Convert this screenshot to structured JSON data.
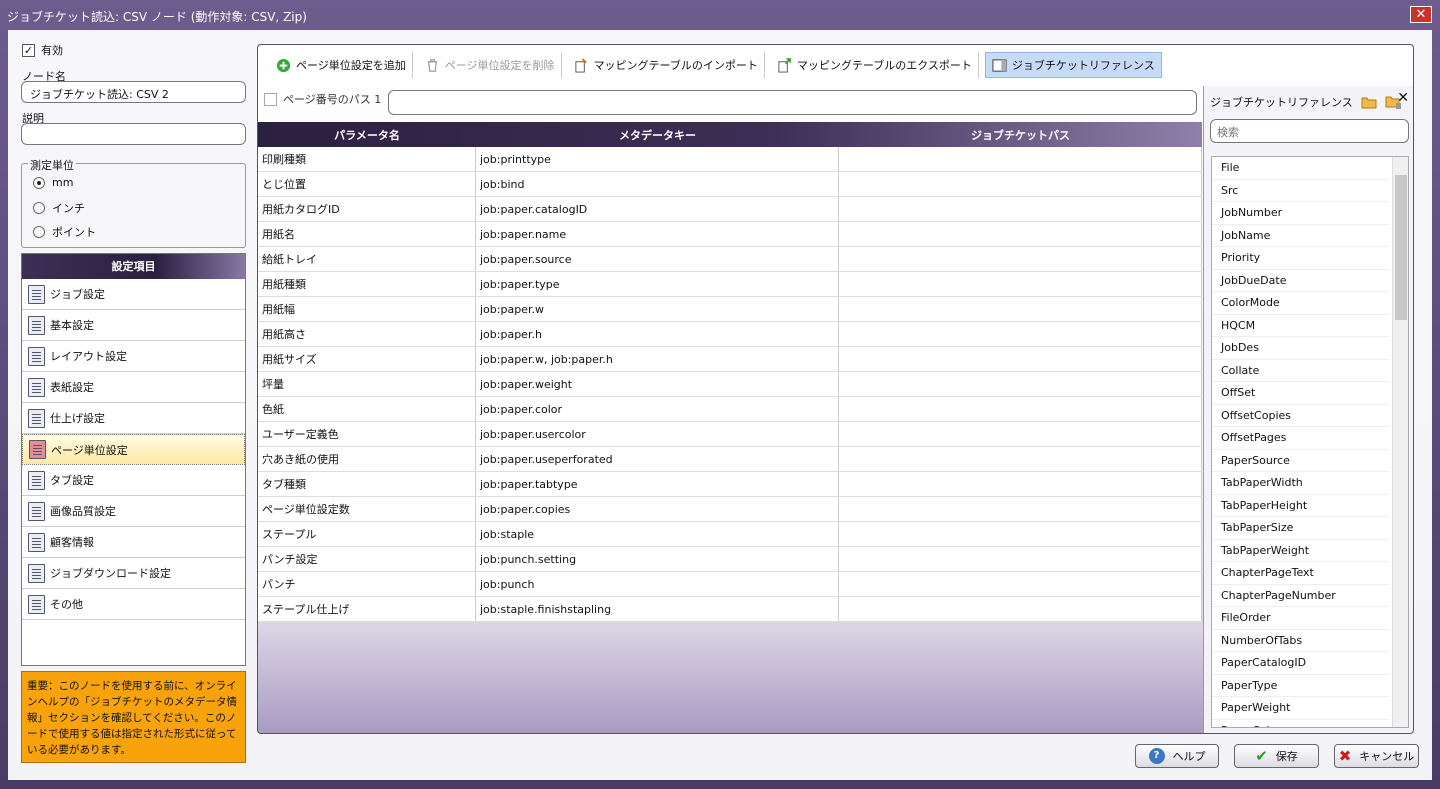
{
  "window": {
    "title": "ジョブチケット読込: CSV ノード (動作対象: CSV, Zip)",
    "close": "✕"
  },
  "left": {
    "enabled_label": "有効",
    "node_name_label": "ノード名",
    "node_name_value": "ジョブチケット読込: CSV 2",
    "description_label": "説明",
    "description_value": "",
    "unit_group_label": "測定単位",
    "units": [
      {
        "label": "mm",
        "selected": true
      },
      {
        "label": "インチ",
        "selected": false
      },
      {
        "label": "ポイント",
        "selected": false
      }
    ],
    "settings_header": "設定項目",
    "settings_items": [
      {
        "label": "ジョブ設定",
        "icon": "document-icon"
      },
      {
        "label": "基本設定",
        "icon": "list-icon"
      },
      {
        "label": "レイアウト設定",
        "icon": "layout-icon"
      },
      {
        "label": "表紙設定",
        "icon": "cover-icon"
      },
      {
        "label": "仕上げ設定",
        "icon": "finishing-icon"
      },
      {
        "label": "ページ単位設定",
        "icon": "pages-icon"
      },
      {
        "label": "タブ設定",
        "icon": "tab-icon"
      },
      {
        "label": "画像品質設定",
        "icon": "image-quality-icon"
      },
      {
        "label": "顧客情報",
        "icon": "customer-icon"
      },
      {
        "label": "ジョブダウンロード設定",
        "icon": "download-icon"
      },
      {
        "label": "その他",
        "icon": "other-icon"
      }
    ],
    "selected_setting_index": 5,
    "note": "重要：このノードを使用する前に、オンラインヘルプの「ジョブチケットのメタデータ情報」セクションを確認してください。このノードで使用する値は指定された形式に従っている必要があります。"
  },
  "toolbar": {
    "add": "ページ単位設定を追加",
    "delete": "ページ単位設定を削除",
    "import": "マッピングテーブルのインポート",
    "export": "マッピングテーブルのエクスポート",
    "reference": "ジョブチケットリファレンス"
  },
  "path_row": {
    "label": "ページ番号のパス 1",
    "value": ""
  },
  "table": {
    "headers": [
      "パラメータ名",
      "メタデータキー",
      "ジョブチケットパス"
    ],
    "rows": [
      [
        "印刷種類",
        "job:printtype",
        ""
      ],
      [
        "とじ位置",
        "job:bind",
        ""
      ],
      [
        "用紙カタログID",
        "job:paper.catalogID",
        ""
      ],
      [
        "用紙名",
        "job:paper.name",
        ""
      ],
      [
        "給紙トレイ",
        "job:paper.source",
        ""
      ],
      [
        "用紙種類",
        "job:paper.type",
        ""
      ],
      [
        "用紙幅",
        "job:paper.w",
        ""
      ],
      [
        "用紙高さ",
        "job:paper.h",
        ""
      ],
      [
        "用紙サイズ",
        "job:paper.w, job:paper.h",
        ""
      ],
      [
        "坪量",
        "job:paper.weight",
        ""
      ],
      [
        "色紙",
        "job:paper.color",
        ""
      ],
      [
        "ユーザー定義色",
        "job:paper.usercolor",
        ""
      ],
      [
        "穴あき紙の使用",
        "job:paper.useperforated",
        ""
      ],
      [
        "タブ種類",
        "job:paper.tabtype",
        ""
      ],
      [
        "ページ単位設定数",
        "job:paper.copies",
        ""
      ],
      [
        "ステープル",
        "job:staple",
        ""
      ],
      [
        "パンチ設定",
        "job:punch.setting",
        ""
      ],
      [
        "パンチ",
        "job:punch",
        ""
      ],
      [
        "ステープル仕上げ",
        "job:staple.finishstapling",
        ""
      ]
    ]
  },
  "reference": {
    "title": "ジョブチケットリファレンス",
    "search_placeholder": "検索",
    "items": [
      "File",
      "Src",
      "JobNumber",
      "JobName",
      "Priority",
      "JobDueDate",
      "ColorMode",
      "HQCM",
      "JobDes",
      "Collate",
      "OffSet",
      "OffsetCopies",
      "OffsetPages",
      "PaperSource",
      "TabPaperWidth",
      "TabPaperHeight",
      "TabPaperSize",
      "TabPaperWeight",
      "ChapterPageText",
      "ChapterPageNumber",
      "FileOrder",
      "NumberOfTabs",
      "PaperCatalogID",
      "PaperType",
      "PaperWeight",
      "PaperColor"
    ]
  },
  "footer": {
    "help": "ヘルプ",
    "save": "保存",
    "cancel": "キャンセル"
  }
}
